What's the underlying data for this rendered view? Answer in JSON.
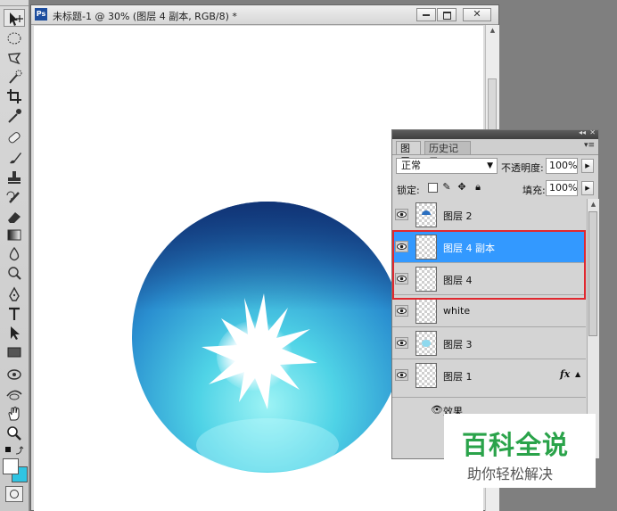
{
  "document": {
    "app_badge": "Ps",
    "title": "未标题-1 @ 30% (图层 4 副本, RGB/8) *"
  },
  "layers_panel": {
    "tabs": [
      "图层",
      "历史记录"
    ],
    "blend_mode": "正常",
    "opacity_label": "不透明度:",
    "opacity_value": "100%",
    "lock_label": "锁定:",
    "fill_label": "填充:",
    "fill_value": "100%",
    "layers": [
      {
        "name": "图层 2",
        "visible": true,
        "selected": false
      },
      {
        "name": "图层 4 副本",
        "visible": true,
        "selected": true
      },
      {
        "name": "图层 4",
        "visible": true,
        "selected": false
      },
      {
        "name": "white",
        "visible": true,
        "selected": false
      },
      {
        "name": "图层 3",
        "visible": true,
        "selected": false
      },
      {
        "name": "图层 1",
        "visible": true,
        "selected": false,
        "fx": "fx"
      }
    ],
    "effects_label": "效果"
  },
  "watermark": {
    "title": "百科全说",
    "subtitle": "助你轻松解决"
  },
  "colors": {
    "selection_blue": "#3399ff",
    "highlight_red": "#e0282f",
    "watermark_green": "#2aa34a",
    "sphere_dark": "#1b4fa0",
    "sphere_light": "#4fd3e6"
  },
  "tools": [
    "move-tool-icon",
    "marquee-tool-icon",
    "lasso-tool-icon",
    "quick-select-tool-icon",
    "crop-tool-icon",
    "eyedropper-tool-icon",
    "healing-brush-tool-icon",
    "brush-tool-icon",
    "clone-stamp-tool-icon",
    "history-brush-tool-icon",
    "eraser-tool-icon",
    "gradient-tool-icon",
    "blur-tool-icon",
    "dodge-tool-icon",
    "pen-tool-icon",
    "type-tool-icon",
    "path-select-tool-icon",
    "shape-tool-icon",
    "3d-rotate-tool-icon",
    "3d-orbit-tool-icon",
    "hand-tool-icon",
    "zoom-tool-icon"
  ]
}
